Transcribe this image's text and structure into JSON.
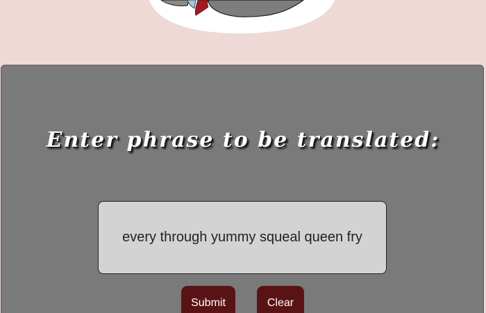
{
  "illustration": {
    "icon": "cartoon-creature-illustration"
  },
  "main": {
    "heading": "Enter phrase to be translated:",
    "phrase_input": {
      "value": "every through yummy squeal queen fry",
      "placeholder": ""
    },
    "buttons": {
      "submit_label": "Submit",
      "clear_label": "Clear"
    }
  },
  "colors": {
    "page_background": "#eed9d7",
    "panel_background": "#7a7a7a",
    "button_background": "#5a1314",
    "input_background": "#d3d3d3"
  }
}
